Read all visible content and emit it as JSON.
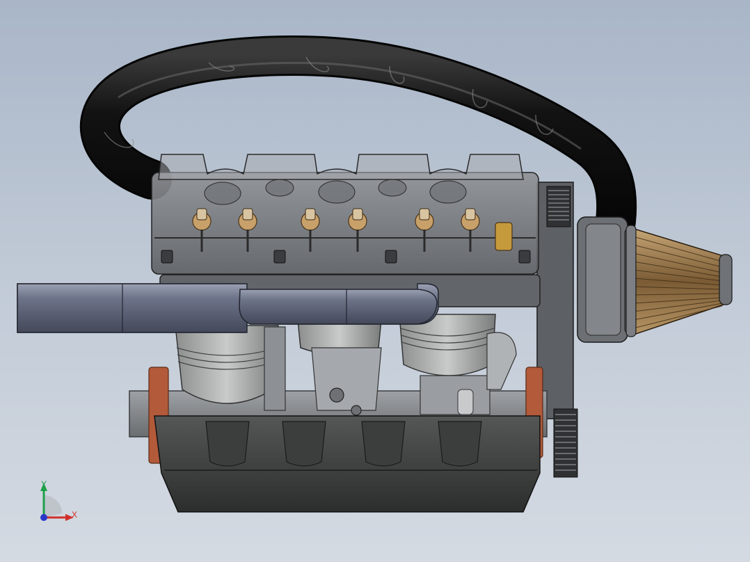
{
  "triad": {
    "y_label": "Y",
    "x_label": "X"
  },
  "colors": {
    "background_top": "#a9b6c8",
    "background_bottom": "#d4dae2",
    "hose": "#141414",
    "exhaust": "#5e6478",
    "copper": "#b25a3a",
    "brass": "#c59a3d",
    "filter_wood": "#8a6c44",
    "triad_y": "#1ea04a",
    "triad_x": "#d0302a",
    "triad_z": "#2a38c8"
  },
  "icons": [
    "engine-model",
    "view-triad"
  ]
}
